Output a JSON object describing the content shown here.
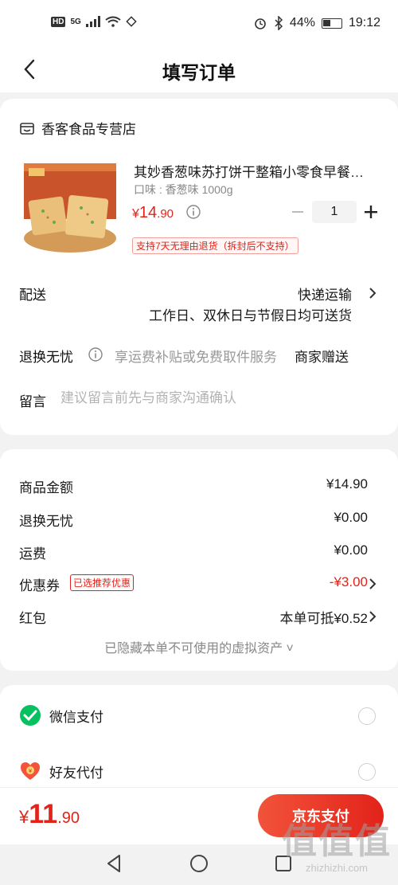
{
  "status_bar": {
    "hd": "HD",
    "signal": "5G",
    "battery_percent": "44%",
    "battery_level": 0.44,
    "time": "19:12"
  },
  "header": {
    "title": "填写订单"
  },
  "store": {
    "name": "香客食品专营店"
  },
  "product": {
    "name": "其妙香葱味苏打饼干整箱小零食早餐…",
    "spec": "口味 : 香葱味 1000g",
    "price_symbol": "¥",
    "price_int": "14",
    "price_dec": ".90",
    "quantity": "1",
    "return_policy": "支持7天无理由退货（拆封后不支持）",
    "image_icon": "cracker-box-image"
  },
  "delivery": {
    "label": "配送",
    "method": "快递运输",
    "note": "工作日、双休日与节假日均可送货"
  },
  "worry_free": {
    "label": "退换无忧",
    "desc": "享运费补贴或免费取件服务",
    "gift": "商家赠送"
  },
  "remark": {
    "label": "留言",
    "placeholder": "建议留言前先与商家沟通确认"
  },
  "summary": {
    "goods_label": "商品金额",
    "goods_value": "¥14.90",
    "worry_label": "退换无忧",
    "worry_value": "¥0.00",
    "shipping_label": "运费",
    "shipping_value": "¥0.00",
    "coupon_label": "优惠券",
    "coupon_tag": "已选推荐优惠",
    "coupon_value": "-¥3.00",
    "redpacket_label": "红包",
    "redpacket_value": "本单可抵¥0.52",
    "hidden_assets": "已隐藏本单不可使用的虚拟资产 ˅"
  },
  "payment": {
    "wechat_label": "微信支付",
    "friend_label": "好友代付"
  },
  "bottom": {
    "total_symbol": "¥",
    "total_int": "11",
    "total_dec": ".90",
    "pay_button": "京东支付"
  },
  "watermark": {
    "line1": "值值值",
    "line2": "zhizhizhi.com"
  },
  "colors": {
    "accent": "#e2231a",
    "wechat": "#07c160"
  }
}
